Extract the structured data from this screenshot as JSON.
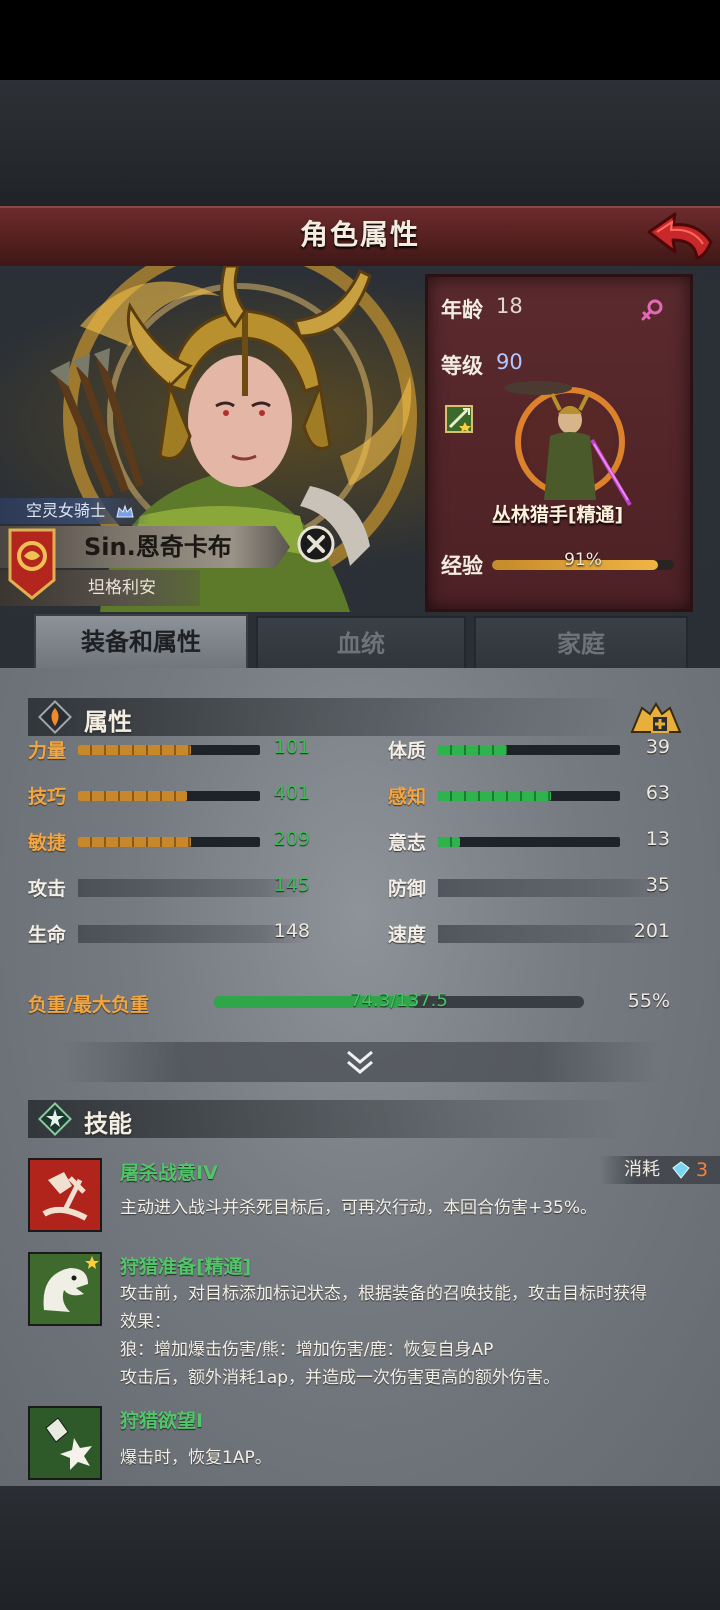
{
  "header": {
    "title": "角色属性"
  },
  "character": {
    "class_title": "空灵女骑士",
    "name": "Sin.恩奇卡布",
    "homeland": "坦格利安"
  },
  "info": {
    "age_label": "年龄",
    "age": "18",
    "level_label": "等级",
    "level": "90",
    "class_name": "丛林猎手[精通]",
    "xp_label": "经验",
    "xp_text": "91%",
    "xp_fraction": 0.91
  },
  "tabs": [
    {
      "label": "装备和属性",
      "active": true
    },
    {
      "label": "血统",
      "active": false
    },
    {
      "label": "家庭",
      "active": false
    }
  ],
  "attributes": {
    "section_title": "属性",
    "left": [
      {
        "label": "力量",
        "value": "101",
        "fraction": 0.62,
        "color": "gold"
      },
      {
        "label": "技巧",
        "value": "401",
        "fraction": 0.6,
        "color": "gold"
      },
      {
        "label": "敏捷",
        "value": "209",
        "fraction": 0.62,
        "color": "gold"
      },
      {
        "label": "攻击",
        "value": "145"
      },
      {
        "label": "生命",
        "value": "148"
      }
    ],
    "right": [
      {
        "label": "体质",
        "value": "39",
        "fraction": 0.38,
        "color": "green"
      },
      {
        "label": "感知",
        "value": "63",
        "fraction": 0.62,
        "color": "green"
      },
      {
        "label": "意志",
        "value": "13",
        "fraction": 0.12,
        "color": "green"
      },
      {
        "label": "防御",
        "value": "35"
      },
      {
        "label": "速度",
        "value": "201"
      }
    ],
    "load_label": "负重/最大负重",
    "load_text": "74.3/137.5",
    "load_percent": "55%",
    "load_fraction": 0.55
  },
  "skills": {
    "section_title": "技能",
    "cost_label": "消耗",
    "items": [
      {
        "name": "屠杀战意IV",
        "cost": "3",
        "lines": [
          "主动进入战斗并杀死目标后，可再次行动，本回合伤害+35%。"
        ]
      },
      {
        "name": "狩猎准备[精通]",
        "lines": [
          "攻击前，对目标添加标记状态，根据装备的召唤技能，攻击目标时获得",
          "效果：",
          "狼：增加爆击伤害/熊：增加伤害/鹿：恢复自身AP",
          "攻击后，额外消耗1ap，并造成一次伤害更高的额外伤害。"
        ]
      },
      {
        "name": "狩猎欲望I",
        "lines": [
          "爆击时，恢复1AP。"
        ]
      }
    ]
  },
  "colors": {
    "header_red": "#5a2224",
    "stat_gold": "#c9872c",
    "stat_green": "#2fb44d",
    "value_green": "#41b85a",
    "skill_green": "#52c46a",
    "cost_orange": "#ff7d3a"
  }
}
